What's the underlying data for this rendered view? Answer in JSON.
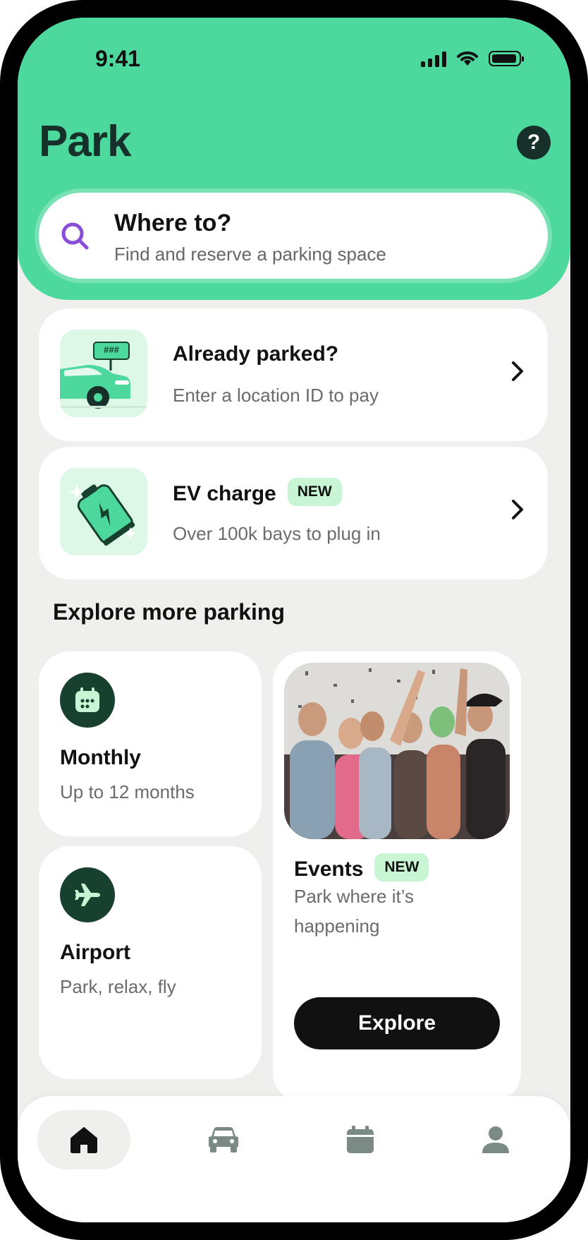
{
  "status_bar": {
    "time": "9:41"
  },
  "header": {
    "title": "Park",
    "help_label": "?"
  },
  "search": {
    "title": "Where to?",
    "subtitle": "Find and reserve a parking space"
  },
  "already_parked": {
    "title": "Already parked?",
    "subtitle": "Enter a location ID to pay",
    "sign_text": "###"
  },
  "ev_charge": {
    "title": "EV charge",
    "badge": "NEW",
    "subtitle": "Over 100k bays to plug in"
  },
  "explore": {
    "title": "Explore more parking",
    "monthly": {
      "title": "Monthly",
      "subtitle": "Up to 12 months"
    },
    "airport": {
      "title": "Airport",
      "subtitle": "Park, relax, fly"
    },
    "events": {
      "title": "Events",
      "badge": "NEW",
      "subtitle_line1": "Park where it’s",
      "subtitle_line2": "happening",
      "button": "Explore"
    }
  },
  "tab_bar": {
    "items": [
      "home-icon",
      "car-icon",
      "calendar-icon",
      "profile-icon"
    ],
    "active": "home-icon"
  },
  "colors": {
    "brand_green": "#4dd89d",
    "dark_green": "#17402f",
    "badge_bg": "#c8f5d4",
    "search_purple": "#8a4dd9"
  }
}
